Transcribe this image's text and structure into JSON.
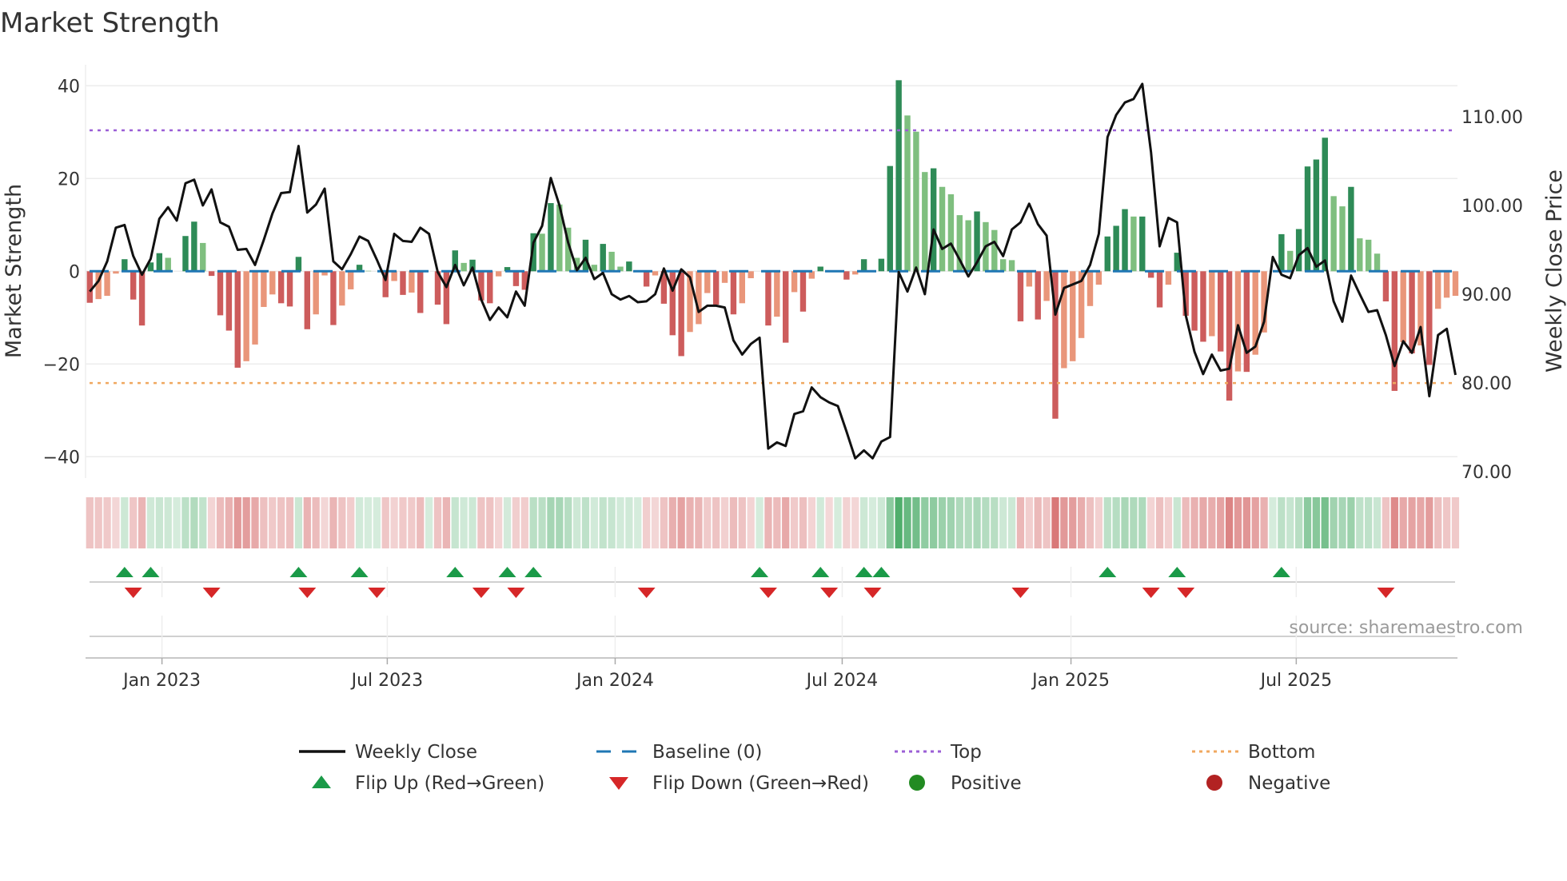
{
  "title": "Market Strength",
  "source": "source: sharemaestro.com",
  "chart_data": {
    "type": "bar+line",
    "title": "Market Strength",
    "ylabel": "Market Strength",
    "y2label": "Weekly Close Price",
    "ylim": [
      -45,
      44.5
    ],
    "y2lim": [
      69.6,
      115.8
    ],
    "yticks": [
      40,
      20,
      0,
      -20,
      -40
    ],
    "ytick_labels": [
      "40",
      "20",
      "0",
      "−20",
      "−40"
    ],
    "y2ticks": [
      110,
      100,
      90,
      80,
      70
    ],
    "y2tick_labels": [
      "110.00",
      "100.00",
      "90.00",
      "80.00",
      "70.00"
    ],
    "xticks": [
      {
        "label": "Jan 2023",
        "week": 9.3
      },
      {
        "label": "Jul 2023",
        "week": 35.2
      },
      {
        "label": "Jan 2024",
        "week": 61.4
      },
      {
        "label": "Jul 2024",
        "week": 87.5
      },
      {
        "label": "Jan 2025",
        "week": 113.8
      },
      {
        "label": "Jul 2025",
        "week": 139.7
      }
    ],
    "grid": true,
    "top_level": 30.4,
    "bottom_level": -24.1,
    "baseline": 0,
    "market_strength": [
      -6.8,
      -6.0,
      -5.3,
      -0.5,
      2.6,
      -6.1,
      -11.7,
      1.9,
      3.9,
      2.9,
      0,
      7.6,
      10.7,
      6.1,
      -1.0,
      -9.5,
      -12.8,
      -20.8,
      -19.4,
      -15.8,
      -7.7,
      -5.0,
      -6.9,
      -7.6,
      3.1,
      -12.5,
      -9.3,
      -0.9,
      -11.6,
      -7.4,
      -3.9,
      1.4,
      0.1,
      0,
      -5.6,
      -2.1,
      -5.1,
      -4.6,
      -9.0,
      0,
      -7.2,
      -11.4,
      4.5,
      1.8,
      2.5,
      -6.3,
      -6.9,
      -1.1,
      0.9,
      -3.2,
      -4.0,
      8.2,
      8.1,
      14.7,
      14.4,
      9.4,
      2.9,
      6.8,
      1.4,
      5.9,
      4.2,
      1.0,
      2.1,
      0,
      -3.3,
      -0.9,
      -7.0,
      -13.8,
      -18.3,
      -13.1,
      -11.4,
      -4.7,
      -7.2,
      -2.5,
      -9.3,
      -6.9,
      -1.5,
      0,
      -11.7,
      -9.8,
      -15.4,
      -4.5,
      -8.7,
      -1.6,
      1.0,
      -0.1,
      0,
      -1.8,
      -0.7,
      2.6,
      0,
      2.7,
      22.7,
      41.2,
      33.6,
      30.1,
      21.4,
      22.2,
      18.2,
      16.6,
      12.1,
      11.0,
      12.9,
      10.6,
      8.9,
      2.6,
      2.4,
      -10.8,
      -3.3,
      -10.4,
      -6.4,
      -31.8,
      -20.9,
      -19.4,
      -14.4,
      -7.5,
      -2.9,
      7.5,
      9.8,
      13.4,
      11.8,
      11.8,
      -1.4,
      -7.8,
      -2.9,
      4.0,
      -9.6,
      -12.8,
      -15.2,
      -14.0,
      -17.3,
      -27.9,
      -21.6,
      -21.7,
      -18.0,
      -13.2,
      0,
      8.0,
      4.4,
      9.1,
      22.6,
      24.1,
      28.8,
      16.2,
      14.0,
      18.2,
      7.1,
      6.8,
      3.8,
      -6.5,
      -25.8,
      -15.3,
      -17.7,
      -16.0,
      -20.2,
      -8.1,
      -5.7,
      -5.3
    ],
    "weekly_close": [
      90.3,
      91.5,
      93.7,
      97.5,
      97.8,
      94.3,
      92.2,
      94.0,
      98.5,
      99.8,
      98.3,
      102.5,
      102.9,
      100.0,
      101.8,
      98.1,
      97.6,
      95.0,
      95.1,
      93.3,
      96.1,
      99.1,
      101.4,
      101.5,
      106.7,
      99.2,
      100.1,
      101.9,
      93.7,
      92.8,
      94.5,
      96.5,
      96.0,
      93.9,
      91.6,
      96.8,
      96.0,
      95.9,
      97.5,
      96.8,
      92.5,
      90.8,
      93.3,
      91.0,
      93.0,
      89.4,
      87.1,
      88.5,
      87.4,
      90.3,
      88.7,
      95.8,
      97.7,
      103.1,
      100.0,
      95.8,
      92.7,
      94.1,
      91.7,
      92.4,
      90.0,
      89.4,
      89.8,
      89.1,
      89.2,
      90.0,
      92.9,
      90.4,
      92.8,
      91.9,
      88.0,
      88.7,
      88.7,
      88.5,
      84.8,
      83.2,
      84.4,
      85.1,
      72.6,
      73.3,
      72.9,
      76.5,
      76.8,
      79.5,
      78.4,
      77.8,
      77.4,
      74.5,
      71.5,
      72.4,
      71.5,
      73.4,
      73.9,
      92.5,
      90.3,
      93.0,
      90.0,
      97.3,
      95.1,
      95.7,
      93.9,
      92.0,
      93.6,
      95.4,
      95.9,
      94.3,
      97.3,
      98.1,
      100.2,
      97.9,
      96.6,
      87.7,
      90.7,
      91.1,
      91.5,
      93.3,
      96.8,
      107.7,
      110.2,
      111.6,
      112.0,
      113.7,
      106.0,
      95.4,
      98.6,
      98.1,
      87.6,
      83.5,
      81.0,
      83.2,
      81.4,
      81.6,
      86.5,
      83.4,
      84.1,
      86.9,
      94.2,
      92.2,
      91.8,
      94.4,
      95.2,
      93.1,
      93.8,
      89.2,
      86.9,
      92.1,
      90.0,
      88.0,
      88.2,
      85.4,
      81.9,
      84.7,
      83.4,
      86.3,
      78.5,
      85.4,
      86.1,
      80.9
    ],
    "flip_up_weeks": [
      5,
      8,
      25,
      32,
      43,
      49,
      52,
      78,
      85,
      90,
      92,
      118,
      126,
      138
    ],
    "flip_down_weeks": [
      6,
      15,
      26,
      34,
      46,
      50,
      65,
      79,
      86,
      91,
      108,
      123,
      127,
      150
    ],
    "legend_position": "bottom-center",
    "legend": [
      {
        "label": "Weekly Close",
        "kind": "line"
      },
      {
        "label": "Baseline (0)",
        "kind": "dashed"
      },
      {
        "label": "Top",
        "kind": "dotted-purple"
      },
      {
        "label": "Bottom",
        "kind": "dotted-orange"
      },
      {
        "label": "Flip Up (Red→Green)",
        "kind": "triangle-up"
      },
      {
        "label": "Flip Down (Green→Red)",
        "kind": "triangle-down"
      },
      {
        "label": "Positive",
        "kind": "circle-green"
      },
      {
        "label": "Negative",
        "kind": "circle-red"
      }
    ]
  },
  "colors": {
    "pos_strong": "#2e8b57",
    "pos_weak": "#7fbf7f",
    "neg_strong": "#cd5c5c",
    "neg_weak": "#e9967a",
    "line": "#111111",
    "baseline": "#1f77b4",
    "top": "#9b5fd6",
    "bottom": "#f0a860",
    "flip_up": "#1a9a48",
    "flip_down": "#d62728",
    "positive": "#228b22",
    "negative": "#b22222"
  }
}
